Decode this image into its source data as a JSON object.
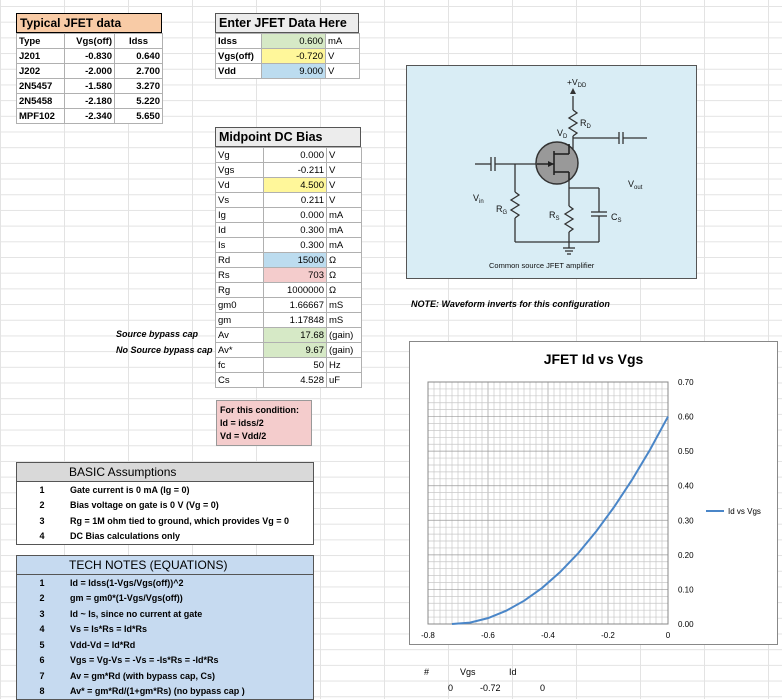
{
  "typical": {
    "title": "Typical JFET data",
    "headers": [
      "Type",
      "Vgs(off)",
      "Idss"
    ],
    "rows": [
      [
        "J201",
        "-0.830",
        "0.640"
      ],
      [
        "J202",
        "-2.000",
        "2.700"
      ],
      [
        "2N5457",
        "-1.580",
        "3.270"
      ],
      [
        "2N5458",
        "-2.180",
        "5.220"
      ],
      [
        "MPF102",
        "-2.340",
        "5.650"
      ]
    ]
  },
  "enter": {
    "title": "Enter JFET Data Here",
    "rows": [
      {
        "label": "Idss",
        "value": "0.600",
        "unit": "mA"
      },
      {
        "label": "Vgs(off)",
        "value": "-0.720",
        "unit": "V"
      },
      {
        "label": "Vdd",
        "value": "9.000",
        "unit": "V"
      }
    ]
  },
  "bias": {
    "title": "Midpoint DC Bias",
    "rows": [
      {
        "label": "Vg",
        "value": "0.000",
        "unit": "V"
      },
      {
        "label": "Vgs",
        "value": "-0.211",
        "unit": "V"
      },
      {
        "label": "Vd",
        "value": "4.500",
        "unit": "V"
      },
      {
        "label": "Vs",
        "value": "0.211",
        "unit": "V"
      },
      {
        "label": "Ig",
        "value": "0.000",
        "unit": "mA"
      },
      {
        "label": "Id",
        "value": "0.300",
        "unit": "mA"
      },
      {
        "label": "Is",
        "value": "0.300",
        "unit": "mA"
      },
      {
        "label": "Rd",
        "value": "15000",
        "unit": "Ω"
      },
      {
        "label": "Rs",
        "value": "703",
        "unit": "Ω"
      },
      {
        "label": "Rg",
        "value": "1000000",
        "unit": "Ω"
      },
      {
        "label": "gm0",
        "value": "1.66667",
        "unit": "mS"
      },
      {
        "label": "gm",
        "value": "1.17848",
        "unit": "mS"
      },
      {
        "label": "Av",
        "value": "17.68",
        "unit": "(gain)"
      },
      {
        "label": "Av*",
        "value": "9.67",
        "unit": "(gain)"
      },
      {
        "label": "fc",
        "value": "50",
        "unit": "Hz"
      },
      {
        "label": "Cs",
        "value": "4.528",
        "unit": "uF"
      }
    ],
    "side_av": "Source bypass cap",
    "side_avstar": "No Source bypass cap"
  },
  "condition": {
    "line1": "For this condition:",
    "line2": "Id = idss/2",
    "line3": "Vd = Vdd/2"
  },
  "assumptions": {
    "title": "BASIC Assumptions",
    "items": [
      {
        "n": "1",
        "text": "Gate current is 0 mA (Ig = 0)"
      },
      {
        "n": "2",
        "text": "Bias voltage on gate is 0 V (Vg = 0)"
      },
      {
        "n": "3",
        "text": "Rg = 1M ohm tied to ground, which provides Vg = 0"
      },
      {
        "n": "4",
        "text": "DC Bias calculations only"
      }
    ]
  },
  "technotes": {
    "title": "TECH NOTES (EQUATIONS)",
    "items": [
      {
        "n": "1",
        "text": "Id = Idss(1-Vgs/Vgs(off))^2"
      },
      {
        "n": "2",
        "text": "gm = gm0*(1-Vgs/Vgs(off))"
      },
      {
        "n": "3",
        "text": "Id ~ Is, since no current at gate"
      },
      {
        "n": "4",
        "text": "Vs = Is*Rs = Id*Rs"
      },
      {
        "n": "5",
        "text": "Vdd-Vd = Id*Rd"
      },
      {
        "n": "6",
        "text": "Vgs = Vg-Vs = -Vs = -Is*Rs = -Id*Rs"
      },
      {
        "n": "7",
        "text": "Av = gm*Rd        (with bypass cap, Cs)"
      },
      {
        "n": "8",
        "text": "Av* = gm*Rd/(1+gm*Rs)   (no bypass cap )"
      }
    ]
  },
  "circuit": {
    "vdd": "+V",
    "vdd_sub": "DD",
    "rd": "R",
    "rd_sub": "D",
    "vd": "V",
    "vd_sub": "D",
    "vout": "V",
    "vout_sub": "out",
    "vin": "V",
    "vin_sub": "in",
    "rg": "R",
    "rg_sub": "G",
    "rs": "R",
    "rs_sub": "S",
    "cs": "C",
    "cs_sub": "S",
    "caption": "Common source JFET amplifier"
  },
  "note": "NOTE:  Waveform inverts for this configuration",
  "bottom_table": {
    "headers": [
      "#",
      "Vgs",
      "Id"
    ],
    "row": [
      "0",
      "-0.72",
      "0"
    ]
  },
  "chart_data": {
    "type": "line",
    "title": "JFET Id vs Vgs",
    "xlabel": "",
    "ylabel": "",
    "xlim": [
      -0.8,
      0
    ],
    "ylim": [
      0,
      0.7
    ],
    "x_ticks": [
      "-0.8",
      "-0.6",
      "-0.4",
      "-0.2",
      "0"
    ],
    "y_ticks": [
      "0.00",
      "0.10",
      "0.20",
      "0.30",
      "0.40",
      "0.50",
      "0.60",
      "0.70"
    ],
    "grid": true,
    "legend_position": "right",
    "series": [
      {
        "name": "Id vs Vgs",
        "color": "#4a86c8",
        "x": [
          -0.72,
          -0.66,
          -0.6,
          -0.54,
          -0.48,
          -0.42,
          -0.36,
          -0.3,
          -0.24,
          -0.18,
          -0.12,
          -0.06,
          0
        ],
        "y": [
          0,
          0.004,
          0.017,
          0.038,
          0.067,
          0.104,
          0.15,
          0.204,
          0.267,
          0.338,
          0.417,
          0.504,
          0.6
        ]
      }
    ]
  }
}
